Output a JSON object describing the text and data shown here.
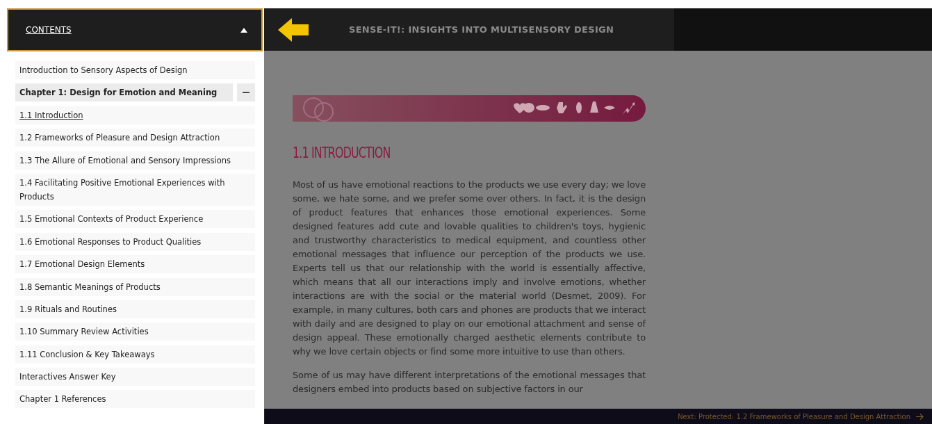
{
  "sidebar": {
    "header": {
      "label": "CONTENTS",
      "expanded": true
    },
    "items": [
      {
        "kind": "item",
        "label": "Introduction to Sensory Aspects of Design"
      },
      {
        "kind": "chapter",
        "label": "Chapter 1: Design for Emotion and Meaning",
        "expanded": true,
        "children": [
          {
            "label": "1.1 Introduction",
            "selected": true
          },
          {
            "label": "1.2 Frameworks of Pleasure and Design Attraction",
            "selected": false
          },
          {
            "label": "1.3 The Allure of Emotional and Sensory Impressions",
            "selected": false
          },
          {
            "label": "1.4 Facilitating Positive Emotional Experiences with Products",
            "selected": false
          },
          {
            "label": "1.5 Emotional Contexts of Product Experience",
            "selected": false
          },
          {
            "label": "1.6 Emotional Responses to Product Qualities",
            "selected": false
          },
          {
            "label": "1.7 Emotional Design Elements",
            "selected": false
          },
          {
            "label": "1.8 Semantic Meanings of Products",
            "selected": false
          },
          {
            "label": "1.9 Rituals and Routines",
            "selected": false
          },
          {
            "label": "1.10 Summary Review Activities",
            "selected": false
          },
          {
            "label": "1.11 Conclusion & Key Takeaways",
            "selected": false
          },
          {
            "label": "Interactives Answer Key",
            "selected": false
          },
          {
            "label": "Chapter 1 References",
            "selected": false
          }
        ]
      }
    ]
  },
  "topbar": {
    "title": "SENSE-IT!: INSIGHTS INTO MULTISENSORY DESIGN"
  },
  "content": {
    "heading": "1.1 INTRODUCTION",
    "paragraphs": [
      "Most of us have emotional reactions to the products we use every day; we love some, we hate some, and we prefer some over others. In fact, it is the design of product features that enhances those emotional experiences. Some designed features add cute and lovable qualities to children's toys, hygienic and trustworthy characteristics to medical equipment, and countless other emotional messages that influence our perception of the products we use. Experts tell us that our relationship with the world is essentially affective, which means that all our interactions imply and involve emotions, whether interactions are with the social or the material world (Desmet, 2009). For example, in many cultures, both cars and phones are products that we interact with daily and are designed to play on our emotional attachment and sense of design appeal. These emotionally charged aesthetic elements contribute to why we love certain objects or find some more intuitive to use than others.",
      "Some of us may have different interpretations of the emotional messages that designers embed into products based on subjective factors in our"
    ]
  },
  "footer": {
    "next": "Next: Protected: 1.2 Frameworks of Pleasure and Design Attraction"
  }
}
